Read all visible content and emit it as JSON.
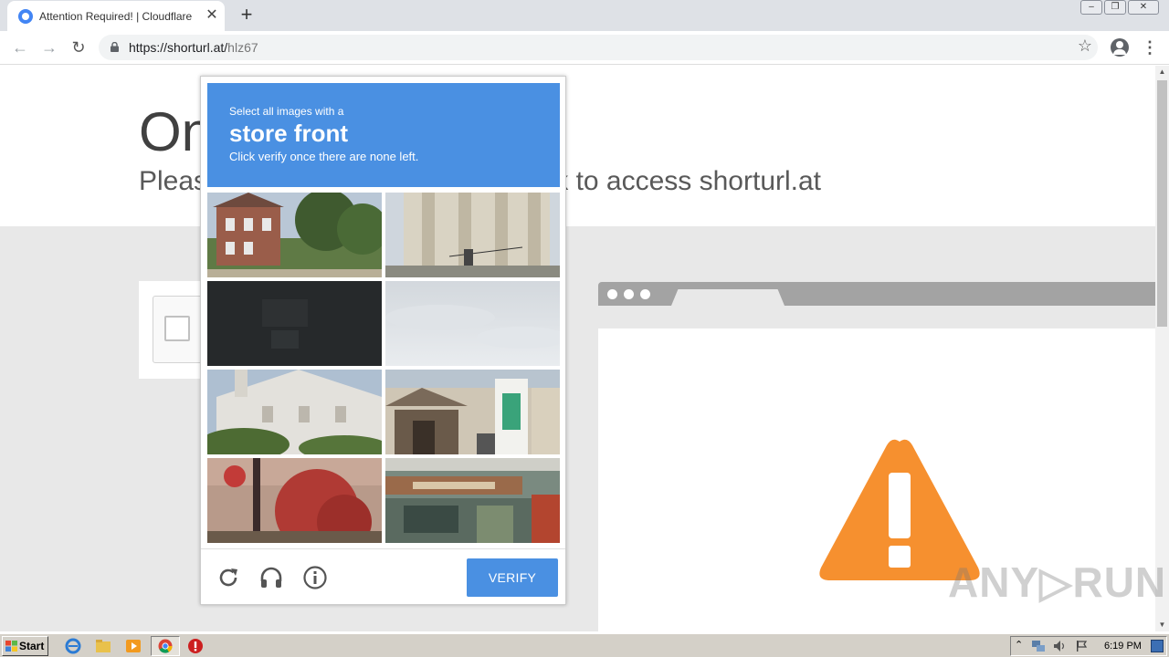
{
  "browser": {
    "tab_title": "Attention Required! | Cloudflare",
    "tab_close": "✕",
    "new_tab": "+",
    "url_host": "https://shorturl.at/",
    "url_path": "hlz67",
    "back": "←",
    "forward": "→",
    "reload": "↻",
    "star": "☆",
    "menu": "⋮",
    "win_min": "–",
    "win_restore": "❐",
    "win_close": "✕"
  },
  "page": {
    "heading": "One more step",
    "subheading": "Please complete the security check to access shorturl.at"
  },
  "captcha": {
    "prompt_line1": "Select all images with a",
    "prompt_target": "store front",
    "prompt_line3": "Click verify once there are none left.",
    "verify_label": "VERIFY",
    "accent": "#4a90e2"
  },
  "watermark": "ANY▷RUN",
  "taskbar": {
    "start_label": "Start",
    "clock": "6:19 PM"
  },
  "scrollbar": {
    "up": "▲",
    "down": "▼"
  }
}
